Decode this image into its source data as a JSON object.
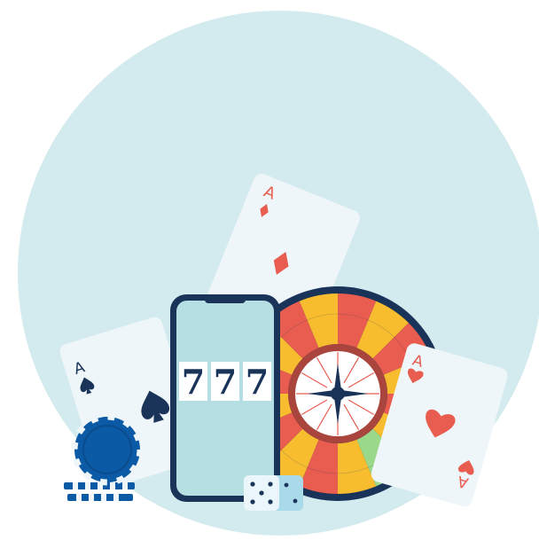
{
  "colors": {
    "background_circle": "#d3ebee",
    "card_face": "#eef6fa",
    "card_red": "#e85d4f",
    "card_black": "#1a3358",
    "phone_body": "#b6dfe3",
    "phone_frame": "#1a3358",
    "roulette_yellow": "#f7bd2f",
    "roulette_red": "#e85d4f",
    "roulette_green": "#9bd98a",
    "chip_blue": "#0b5aa5",
    "dice_face": "#eaf6fa",
    "dice_side": "#a9daea"
  },
  "slot_machine": {
    "reel_1": "7",
    "reel_2": "7",
    "reel_3": "7"
  },
  "cards": {
    "back_card_rank": "A",
    "left_card_rank": "A",
    "right_card_rank_top": "A",
    "right_card_rank_bottom": "A"
  },
  "icons": {
    "suits": [
      "diamond-icon",
      "spade-icon",
      "heart-icon"
    ],
    "objects": [
      "smartphone-icon",
      "roulette-wheel-icon",
      "poker-chip-icon",
      "dice-icon"
    ]
  }
}
